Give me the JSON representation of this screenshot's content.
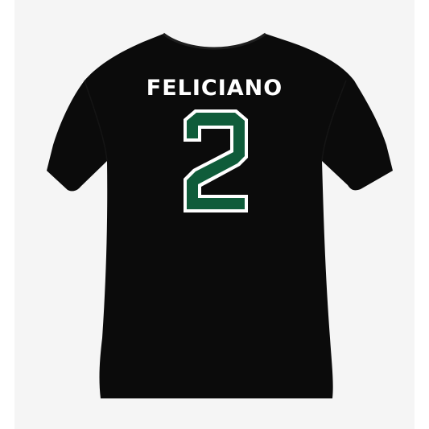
{
  "product": {
    "player_name": "FELICIANO",
    "jersey_number": "2",
    "shirt_color": "#0b0b0b",
    "number_fill_color": "#0f5c3a",
    "number_outline_color": "#ffffff",
    "name_color": "#ffffff",
    "background_color": "#f5f5f5"
  }
}
